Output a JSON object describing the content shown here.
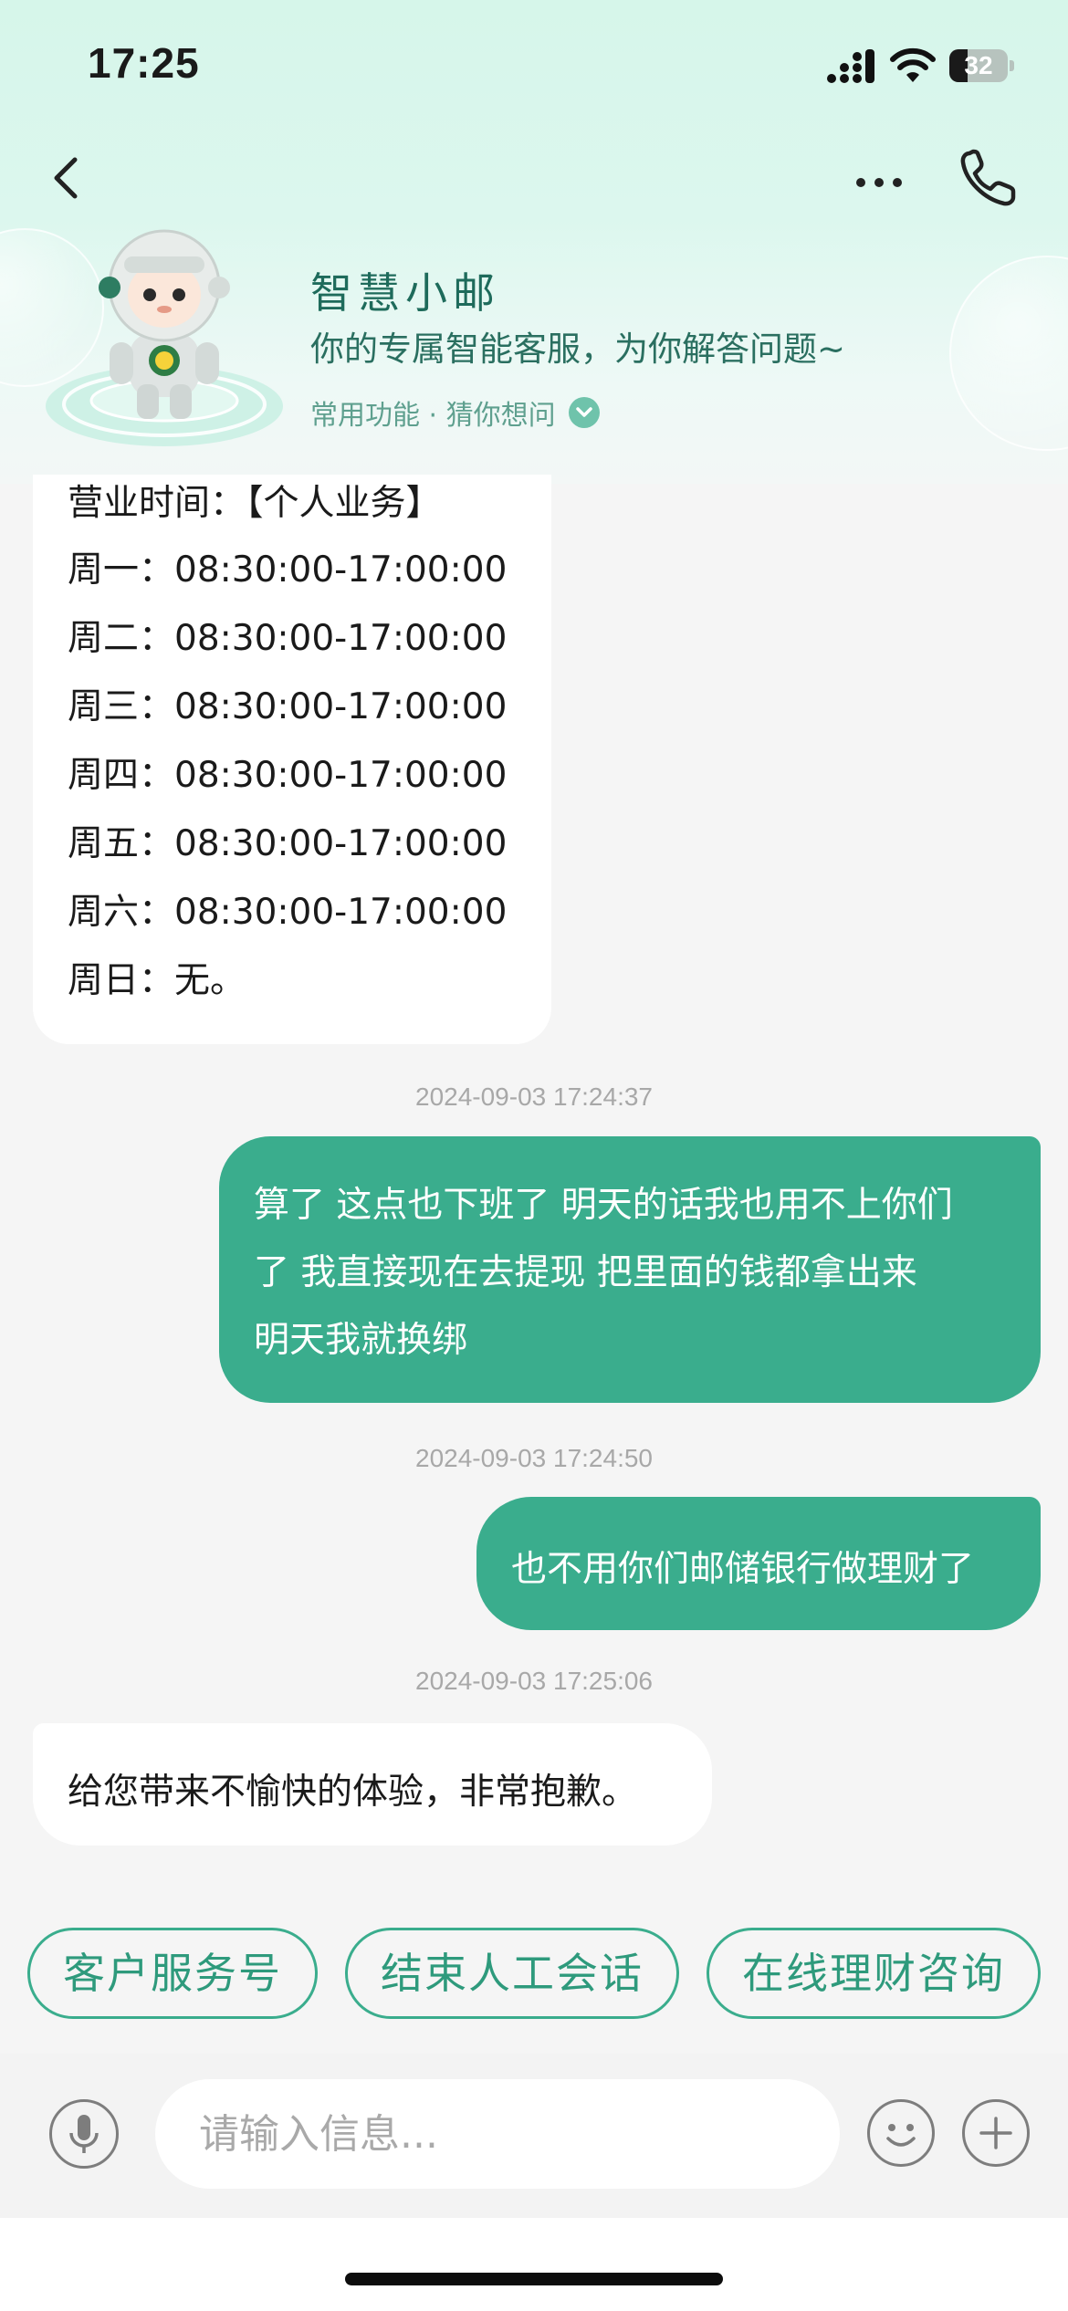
{
  "status_bar": {
    "time": "17:25",
    "battery": "32",
    "battery_level": 0.32
  },
  "header": {
    "back_icon": "chevron-left-icon",
    "more_icon": "more-dots-icon",
    "call_icon": "phone-icon",
    "bot_name": "智慧小邮",
    "bot_description": "你的专属智能客服，为你解答问题~",
    "quick_functions": "常用功能 · 猜你想问",
    "avatar_icon": "astronaut-robot-avatar"
  },
  "messages": {
    "hours": {
      "title": "营业时间：【个人业务】",
      "lines": [
        "周一：08:30:00-17:00:00",
        "周二：08:30:00-17:00:00",
        "周三：08:30:00-17:00:00",
        "周四：08:30:00-17:00:00",
        "周五：08:30:00-17:00:00",
        "周六：08:30:00-17:00:00",
        "周日：无。"
      ]
    },
    "ts1": "2024-09-03 17:24:37",
    "user1": {
      "lines": [
        "算了 这点也下班了 明天的话我也用不上你们",
        "了 我直接现在去提现 把里面的钱都拿出来",
        "明天我就换绑"
      ]
    },
    "ts2": "2024-09-03 17:24:50",
    "user2": "也不用你们邮储银行做理财了",
    "ts3": "2024-09-03 17:25:06",
    "bot2": "给您带来不愉快的体验，非常抱歉。"
  },
  "quick_replies": [
    "客户服务号",
    "结束人工会话",
    "在线理财咨询"
  ],
  "composer": {
    "placeholder": "请输入信息...",
    "mic_icon": "microphone-icon",
    "emoji_icon": "smiley-icon",
    "plus_icon": "plus-icon"
  },
  "colors": {
    "accent": "#3aad8d",
    "header_gradient_top": "#d6f6ea",
    "bot_name": "#1e6b5b"
  }
}
